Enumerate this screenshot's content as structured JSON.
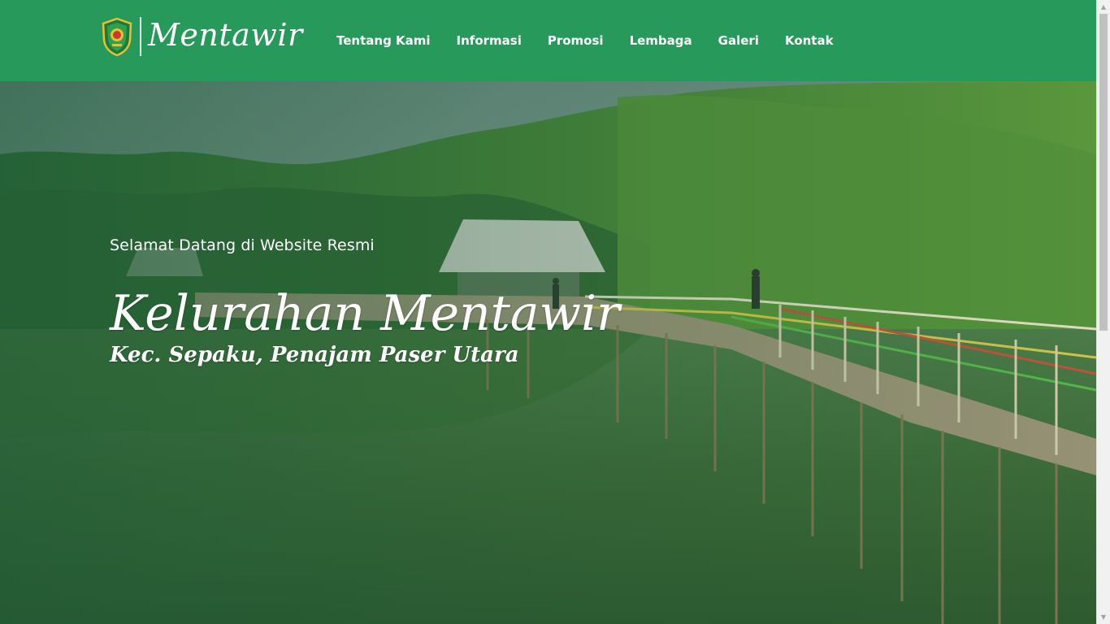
{
  "header": {
    "brand_name": "Mentawir",
    "emblem_icon": "regency-emblem-icon",
    "nav": [
      {
        "label": "Tentang Kami"
      },
      {
        "label": "Informasi"
      },
      {
        "label": "Promosi"
      },
      {
        "label": "Lembaga"
      },
      {
        "label": "Galeri"
      },
      {
        "label": "Kontak"
      }
    ],
    "background_color": "#27995b"
  },
  "hero": {
    "welcome": "Selamat Datang di Website Resmi",
    "title": "Kelurahan Mentawir",
    "subtitle": "Kec. Sepaku, Penajam Paser Utara",
    "background": "mangrove-boardwalk-photo"
  },
  "scrollbar": {
    "up_icon": "scroll-up-arrow-icon",
    "down_icon": "scroll-down-arrow-icon"
  }
}
